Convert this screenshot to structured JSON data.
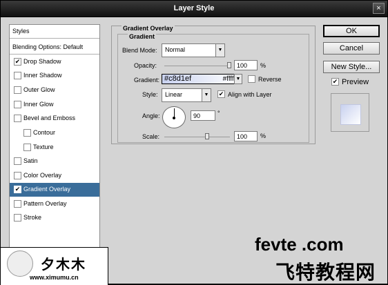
{
  "window": {
    "title": "Layer Style",
    "close": "×"
  },
  "sidebar": {
    "items": [
      {
        "label": "Styles",
        "checkbox": false,
        "checked": false,
        "selected": false
      },
      {
        "label": "Blending Options: Default",
        "checkbox": false,
        "checked": false,
        "selected": false
      },
      {
        "label": "Drop Shadow",
        "checkbox": true,
        "checked": true,
        "selected": false
      },
      {
        "label": "Inner Shadow",
        "checkbox": true,
        "checked": false,
        "selected": false
      },
      {
        "label": "Outer Glow",
        "checkbox": true,
        "checked": false,
        "selected": false
      },
      {
        "label": "Inner Glow",
        "checkbox": true,
        "checked": false,
        "selected": false
      },
      {
        "label": "Bevel and Emboss",
        "checkbox": true,
        "checked": false,
        "selected": false
      },
      {
        "label": "Contour",
        "checkbox": true,
        "checked": false,
        "selected": false
      },
      {
        "label": "Texture",
        "checkbox": true,
        "checked": false,
        "selected": false
      },
      {
        "label": "Satin",
        "checkbox": true,
        "checked": false,
        "selected": false
      },
      {
        "label": "Color Overlay",
        "checkbox": true,
        "checked": false,
        "selected": false
      },
      {
        "label": "Gradient Overlay",
        "checkbox": true,
        "checked": true,
        "selected": true
      },
      {
        "label": "Pattern Overlay",
        "checkbox": true,
        "checked": false,
        "selected": false
      },
      {
        "label": "Stroke",
        "checkbox": true,
        "checked": false,
        "selected": false
      }
    ]
  },
  "panel": {
    "group_title": "Gradient Overlay",
    "sub_title": "Gradient",
    "blend_mode_label": "Blend Mode:",
    "blend_mode_value": "Normal",
    "opacity_label": "Opacity:",
    "opacity_value": "100",
    "opacity_unit": "%",
    "opacity_fraction": 1.0,
    "gradient_label": "Gradient:",
    "gradient_color1": "#c8d1ef",
    "gradient_color2": "#ffffff",
    "reverse_label": "Reverse",
    "reverse_checked": false,
    "style_label": "Style:",
    "style_value": "Linear",
    "align_label": "Align with Layer",
    "align_checked": true,
    "angle_label": "Angle:",
    "angle_value": "90",
    "angle_unit": "°",
    "scale_label": "Scale:",
    "scale_value": "100",
    "scale_unit": "%",
    "scale_fraction": 0.66
  },
  "buttons": {
    "ok": "OK",
    "cancel": "Cancel",
    "new_style": "New Style...",
    "preview_label": "Preview",
    "preview_checked": true
  },
  "watermarks": {
    "left_cn": "夕木木",
    "left_url": "www.ximumu.cn",
    "right_en": "fevte .com",
    "right_cn": "飞特教程网"
  },
  "icons": {
    "check": "✔",
    "dropdown": "▼"
  }
}
